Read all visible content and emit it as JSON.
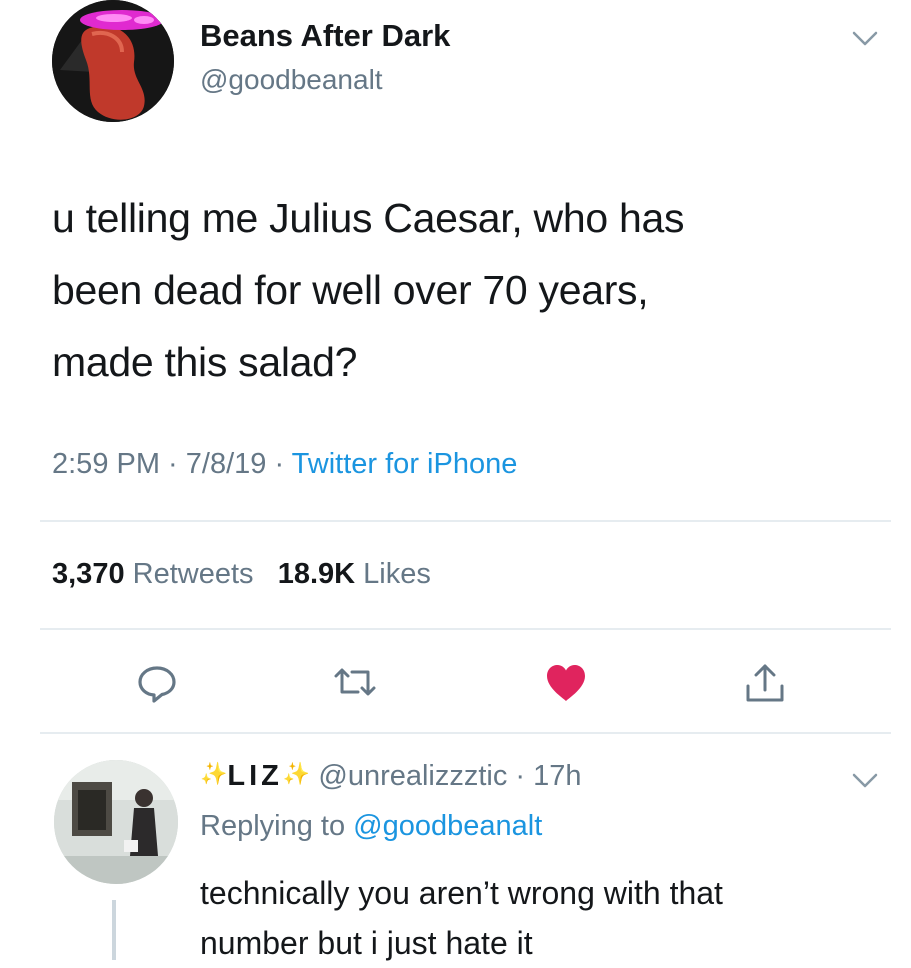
{
  "tweet": {
    "display_name": "Beans After Dark",
    "handle": "@goodbeanalt",
    "text_lines": [
      "u telling me Julius Caesar, who has",
      "been dead for well over 70 years,",
      "made this salad?"
    ],
    "time": "2:59 PM",
    "date": "7/8/19",
    "source": "Twitter for iPhone",
    "retweets_count": "3,370",
    "retweets_label": "Retweets",
    "likes_count": "18.9K",
    "likes_label": "Likes",
    "liked": true
  },
  "reply": {
    "display_name": "LIZ",
    "handle": "@unrealizzztic",
    "time_ago": "17h",
    "replying_label": "Replying to",
    "replying_to": "@goodbeanalt",
    "text_lines": [
      "technically you aren’t wrong with that",
      "number but i just hate it"
    ]
  },
  "icons": {
    "caret": "chevron-down-icon",
    "reply": "reply-icon",
    "retweet": "retweet-icon",
    "like": "heart-icon",
    "share": "share-icon"
  },
  "colors": {
    "text": "#14171a",
    "secondary": "#657786",
    "link": "#1b95e0",
    "like": "#e0245e",
    "divider": "#e6ecf0"
  }
}
